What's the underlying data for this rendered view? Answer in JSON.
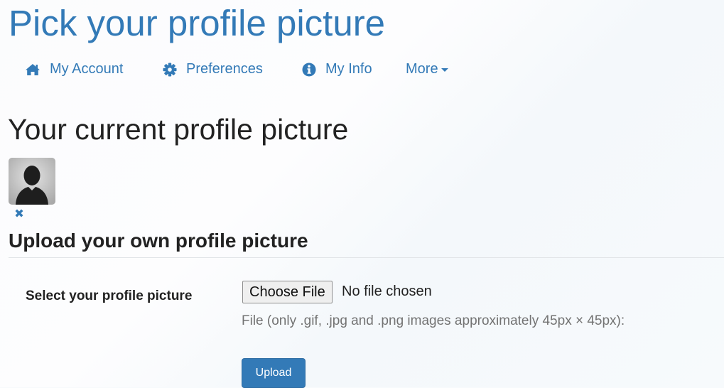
{
  "page_title": "Pick your profile picture",
  "nav": {
    "items": [
      {
        "label": "My Account",
        "icon": "home-icon"
      },
      {
        "label": "Preferences",
        "icon": "gear-icon"
      },
      {
        "label": "My Info",
        "icon": "info-circle-icon"
      },
      {
        "label": "More",
        "icon": "caret-down-icon"
      }
    ]
  },
  "current": {
    "title": "Your current profile picture",
    "avatar_icon": "default-user-silhouette",
    "remove_icon": "close-icon"
  },
  "upload": {
    "title": "Upload your own profile picture",
    "field_label": "Select your profile picture",
    "choose_file_label": "Choose File",
    "file_status": "No file chosen",
    "help_text": "File (only .gif, .jpg and .png images approximately 45px × 45px):",
    "upload_button_label": "Upload"
  },
  "colors": {
    "link": "#337ab7",
    "primary_button": "#337ab7",
    "heading": "#222222",
    "help_text": "#737373"
  }
}
